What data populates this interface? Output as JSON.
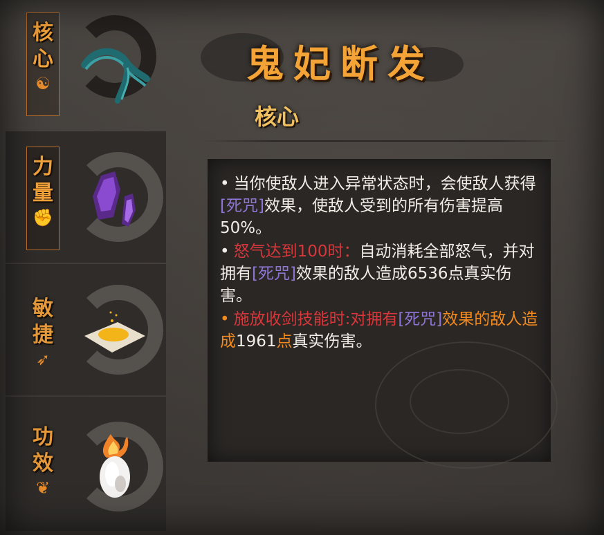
{
  "tabs": [
    {
      "label_1": "核",
      "label_2": "心",
      "symbol": "☯",
      "active": true
    },
    {
      "label_1": "力",
      "label_2": "量",
      "symbol": "✊",
      "active": false
    },
    {
      "label_1": "敏",
      "label_2": "捷",
      "symbol": "➶",
      "active": false
    },
    {
      "label_1": "功",
      "label_2": "效",
      "symbol": "❦",
      "active": false
    }
  ],
  "item": {
    "title": "鬼妃断发",
    "category": "核心"
  },
  "description": {
    "line1_a": "当你使敌人进入异常状态时，会使敌人获得",
    "line1_tag": "[死咒]",
    "line1_b": "效果，使敌人受到的所有伤害提高50%。",
    "line2_red": "怒气达到100时：",
    "line2_a": "自动消耗全部怒气，并对拥有",
    "line2_tag": "[死咒]",
    "line2_b": "效果的敌人造成6536点真实伤害。",
    "line3_orange_a": "施放收剑技能时:对拥有",
    "line3_tag": "[死咒]",
    "line3_orange_b": "效果的敌人造成",
    "line3_num": "1961",
    "line3_orange_c": "点",
    "line3_end": "真实伤害。"
  },
  "colors": {
    "title": "#f4a437",
    "tag_purple": "#8f76d6",
    "red": "#d8373b",
    "orange": "#f28a1e"
  }
}
